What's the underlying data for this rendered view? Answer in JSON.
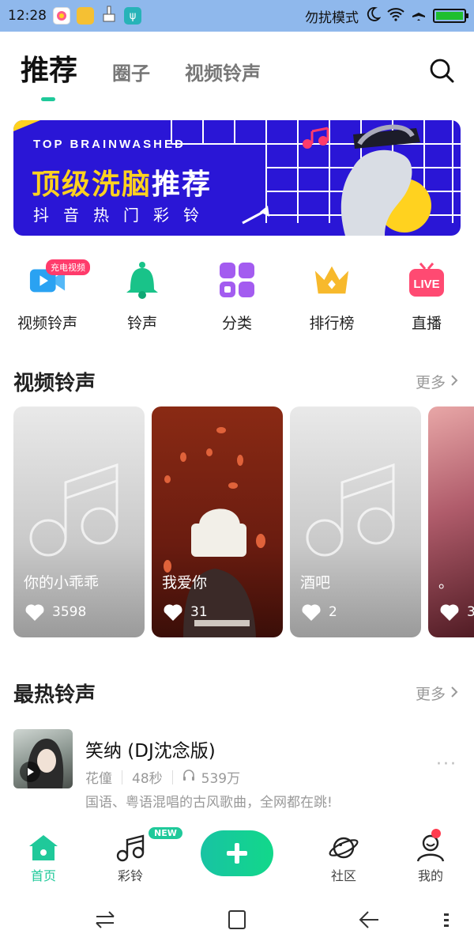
{
  "status_bar": {
    "time": "12:28",
    "dnd_text": "勿扰模式"
  },
  "header": {
    "tabs": [
      {
        "label": "推荐",
        "active": true
      },
      {
        "label": "圈子",
        "active": false
      },
      {
        "label": "视频铃声",
        "active": false
      }
    ],
    "search_icon": "search-icon"
  },
  "banner": {
    "subtitle": "TOP BRAINWASHED",
    "title_highlight": "顶级洗脑",
    "title_rest": "推荐",
    "desc": "抖音热门彩铃"
  },
  "quick_entries": [
    {
      "label": "视频铃声",
      "icon": "video-icon",
      "badge": "充电视频"
    },
    {
      "label": "铃声",
      "icon": "bell-icon"
    },
    {
      "label": "分类",
      "icon": "grid-icon"
    },
    {
      "label": "排行榜",
      "icon": "crown-icon"
    },
    {
      "label": "直播",
      "icon": "live-icon",
      "icon_text": "LIVE"
    }
  ],
  "video_section": {
    "title": "视频铃声",
    "more": "更多",
    "cards": [
      {
        "title": "你的小乖乖",
        "likes": "3598"
      },
      {
        "title": "我爱你",
        "likes": "31"
      },
      {
        "title": "酒吧",
        "likes": "2"
      },
      {
        "title": "。",
        "likes": "3"
      }
    ]
  },
  "hot_section": {
    "title": "最热铃声",
    "more": "更多",
    "songs": [
      {
        "title": "笑纳 (DJ沈念版)",
        "artist": "花僮",
        "duration": "48秒",
        "plays": "539万",
        "desc": "国语、粤语混唱的古风歌曲，全网都在跳!",
        "menu": "···"
      }
    ]
  },
  "bottom_nav": {
    "items": [
      {
        "label": "首页",
        "active": true
      },
      {
        "label": "彩铃",
        "badge": "NEW"
      },
      {
        "label": "社区"
      },
      {
        "label": "我的"
      }
    ]
  },
  "colors": {
    "accent": "#1fc99a",
    "banner_bg": "#2a16d6",
    "banner_highlight": "#ffd21f",
    "status_bar": "#8fb8ec"
  }
}
